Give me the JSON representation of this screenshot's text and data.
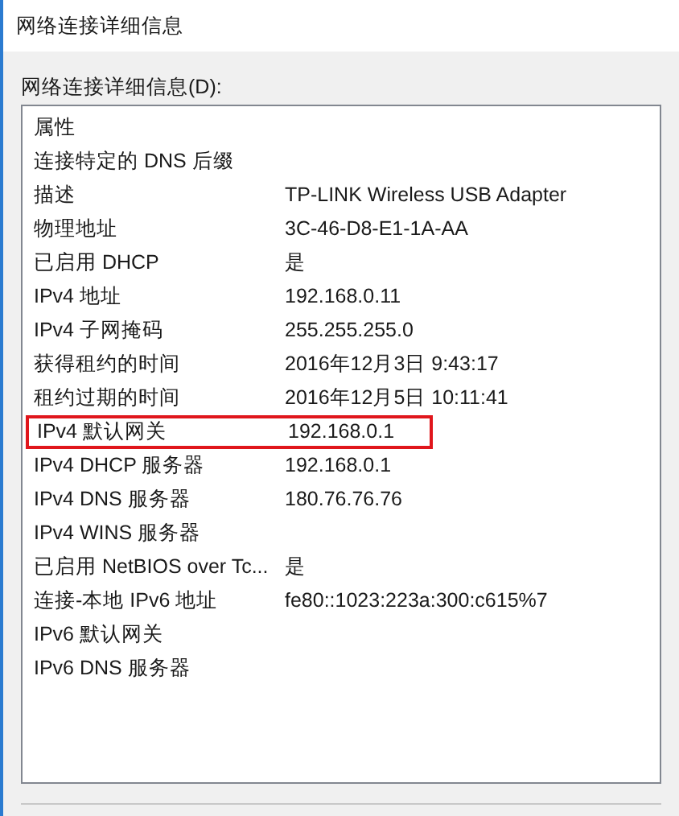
{
  "window": {
    "title": "网络连接详细信息"
  },
  "list_label": "网络连接详细信息(D):",
  "table": {
    "columns": [
      "属性"
    ],
    "rows": [
      {
        "property": "连接特定的 DNS 后缀",
        "value": "",
        "highlighted": false
      },
      {
        "property": "描述",
        "value": "TP-LINK Wireless USB Adapter",
        "highlighted": false
      },
      {
        "property": "物理地址",
        "value": "3C-46-D8-E1-1A-AA",
        "highlighted": false
      },
      {
        "property": "已启用 DHCP",
        "value": "是",
        "highlighted": false
      },
      {
        "property": "IPv4 地址",
        "value": "192.168.0.11",
        "highlighted": false
      },
      {
        "property": "IPv4 子网掩码",
        "value": "255.255.255.0",
        "highlighted": false
      },
      {
        "property": "获得租约的时间",
        "value": "2016年12月3日 9:43:17",
        "highlighted": false
      },
      {
        "property": "租约过期的时间",
        "value": "2016年12月5日 10:11:41",
        "highlighted": false
      },
      {
        "property": "IPv4 默认网关",
        "value": "192.168.0.1",
        "highlighted": true
      },
      {
        "property": "IPv4 DHCP 服务器",
        "value": "192.168.0.1",
        "highlighted": false
      },
      {
        "property": "IPv4 DNS 服务器",
        "value": "180.76.76.76",
        "highlighted": false
      },
      {
        "property": "IPv4 WINS 服务器",
        "value": "",
        "highlighted": false
      },
      {
        "property": "已启用 NetBIOS over Tc...",
        "value": "是",
        "highlighted": false
      },
      {
        "property": "连接-本地 IPv6 地址",
        "value": "fe80::1023:223a:300:c615%7",
        "highlighted": false
      },
      {
        "property": "IPv6 默认网关",
        "value": "",
        "highlighted": false
      },
      {
        "property": "IPv6 DNS 服务器",
        "value": "",
        "highlighted": false
      }
    ]
  }
}
